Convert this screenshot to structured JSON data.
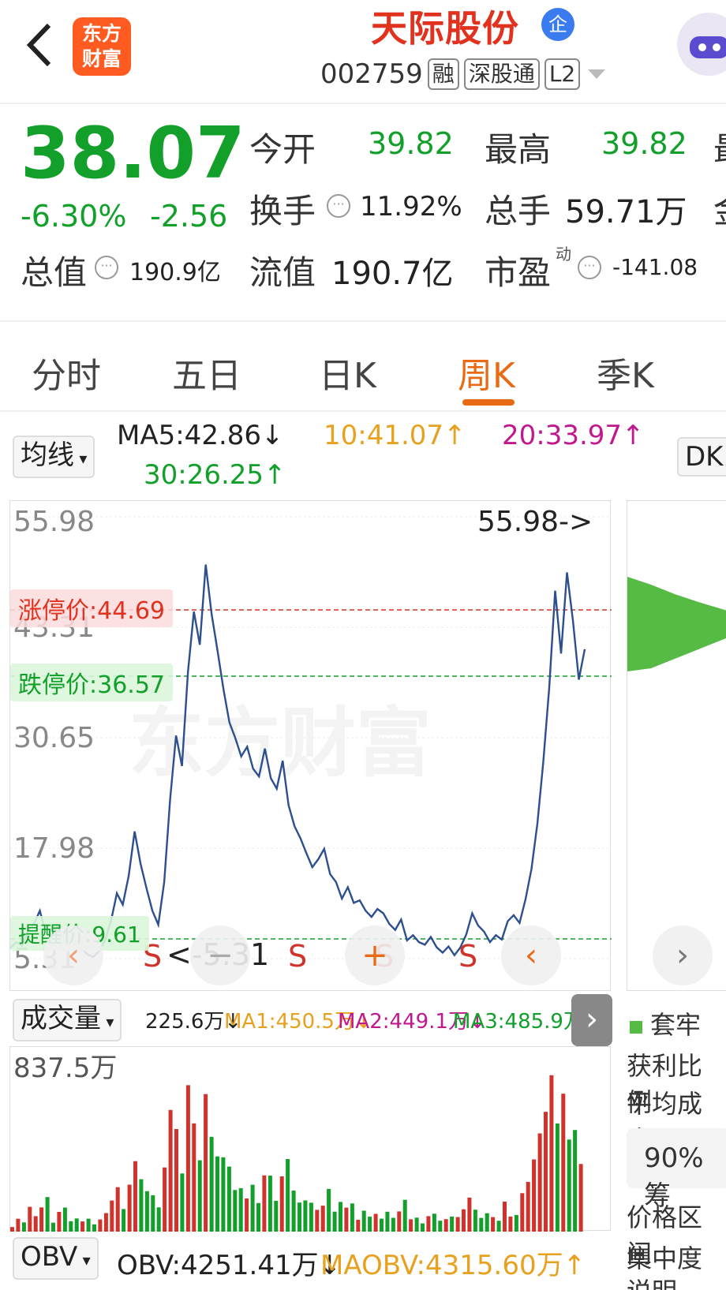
{
  "header": {
    "back_icon": "chevron-left-icon",
    "logo_line1": "东方",
    "logo_line2": "财富",
    "stock_name": "天际股份",
    "qi_badge": "企",
    "code": "002759",
    "tags": [
      "融",
      "深股通",
      "L2"
    ]
  },
  "quote": {
    "price": "38.07",
    "change_pct": "-6.30%",
    "change_amt": "-2.56",
    "open_label": "今开",
    "open_value": "39.82",
    "high_label": "最高",
    "high_value": "39.82",
    "turnover_label": "换手",
    "turnover_value": "11.92%",
    "volume_label": "总手",
    "volume_value": "59.71万",
    "total_value_label": "总值",
    "total_value": "190.9亿",
    "float_value_label": "流值",
    "float_value": "190.7亿",
    "pe_label": "市盈",
    "pe_super": "动",
    "pe_value": "-141.08",
    "cut_right_1": "最",
    "cut_right_2": "金"
  },
  "tabs": [
    "分时",
    "五日",
    "日K",
    "周K",
    "季K"
  ],
  "active_tab": "周K",
  "ma_row": {
    "selector": "均线",
    "ma5": "MA5:42.86↓",
    "ma10": "10:41.07↑",
    "ma20": "20:33.97↑",
    "ma30": "30:26.25↑",
    "dk_button": "DK"
  },
  "chart": {
    "axis_labels": [
      "55.98",
      "43.31",
      "30.65",
      "17.98",
      "5.31"
    ],
    "max_annotation": "55.98->",
    "min_annotation": "<-5.31",
    "limit_up": "涨停价:44.69",
    "limit_down": "跌停价:36.57",
    "alert": "提醒价:9.61",
    "sell_marks": [
      "S",
      "S",
      "S",
      "S"
    ],
    "watermark": "东方财富",
    "colors": {
      "line": "#2d4f8e",
      "limit_up": "#e0321f",
      "limit_down": "#12a02b",
      "profile": "#55bb44"
    }
  },
  "chart_data": {
    "type": "line",
    "title": "",
    "xlabel": "",
    "ylabel": "",
    "ylim": [
      5.31,
      55.98
    ],
    "series": [
      {
        "values": [
          6.5,
          7.2,
          6.8,
          8.5,
          9.3,
          10.8,
          8.2,
          7.9,
          9.1,
          7.4,
          6.9,
          6.1,
          6.6,
          5.8,
          5.5,
          6.2,
          7.4,
          9.6,
          12.8,
          11.5,
          14.8,
          19.9,
          16.2,
          13.4,
          10.8,
          9.2,
          14.1,
          23.6,
          30.9,
          27.4,
          38.2,
          45.1,
          41.3,
          50.5,
          44.8,
          40.6,
          36.2,
          32.4,
          30.6,
          28.5,
          29.6,
          27.1,
          26.2,
          29.4,
          26.0,
          24.8,
          28.0,
          22.9,
          20.5,
          19.1,
          17.4,
          15.8,
          16.7,
          17.9,
          15.0,
          14.1,
          12.2,
          13.5,
          11.7,
          12.0,
          10.8,
          10.1,
          11.0,
          10.5,
          9.3,
          8.6,
          9.8,
          7.4,
          8.0,
          7.2,
          6.9,
          7.8,
          6.6,
          6.0,
          6.7,
          5.7,
          6.6,
          8.1,
          10.5,
          9.1,
          8.4,
          7.2,
          8.0,
          7.5,
          9.6,
          10.3,
          9.4,
          12.1,
          15.6,
          20.8,
          27.9,
          36.4,
          47.5,
          40.3,
          49.6,
          44.1,
          37.3,
          40.8
        ]
      }
    ],
    "volume": {
      "max_label": "837.5万",
      "current": "225.6万↓",
      "ma1": "MA1:450.5万↓",
      "ma2": "MA2:449.1万↓",
      "ma3": "MA3:485.9万↓"
    },
    "obv": {
      "obv": "OBV:4251.41万↓",
      "maobv": "MAOBV:4315.60万↑"
    }
  },
  "volume_header": {
    "selector": "成交量"
  },
  "obv_row": {
    "selector": "OBV"
  },
  "side": {
    "legend": "套牢",
    "profit_ratio": "获利比例",
    "avg_cost": "平均成本",
    "chip_pct": "90%筹",
    "price_range": "价格区间",
    "concentration": "集中度",
    "explain": "说明"
  }
}
